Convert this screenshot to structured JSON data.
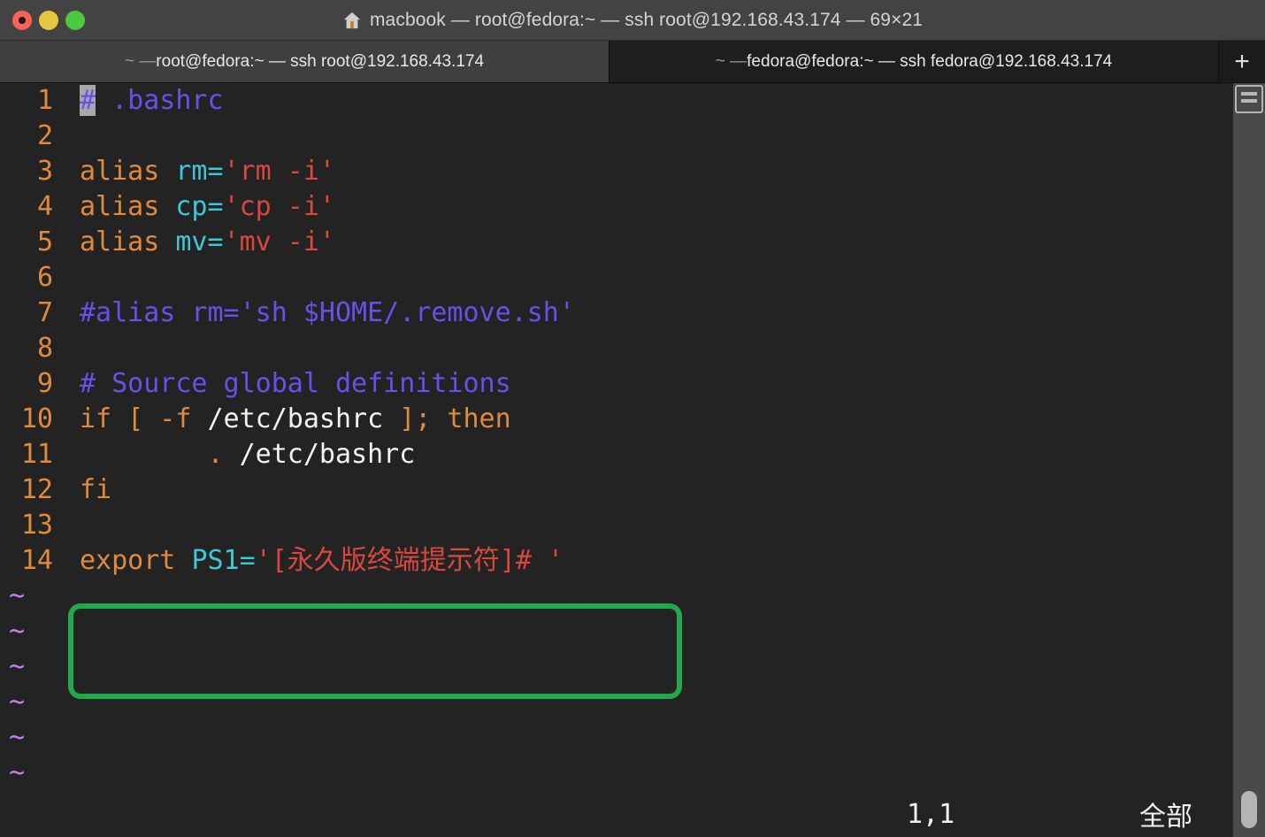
{
  "window": {
    "title": "macbook — root@fedora:~ — ssh root@192.168.43.174 — 69×21",
    "icon": "house-icon",
    "controls": {
      "close": "close-button",
      "minimize": "minimize-button",
      "zoom": "zoom-button"
    }
  },
  "tabs": [
    {
      "prefix": "~ — ",
      "label": "root@fedora:~ — ssh root@192.168.43.174",
      "active": true
    },
    {
      "prefix": "~ — ",
      "label": "fedora@fedora:~ — ssh fedora@192.168.43.174",
      "active": false
    }
  ],
  "new_tab_label": "+",
  "editor": {
    "lines": [
      {
        "num": "1",
        "segments": [
          {
            "text": "#",
            "cls": "cursor"
          },
          {
            "text": " .bashrc",
            "cls": "c-comment"
          }
        ]
      },
      {
        "num": "2",
        "segments": []
      },
      {
        "num": "3",
        "segments": [
          {
            "text": "alias ",
            "cls": "c-kw"
          },
          {
            "text": "rm=",
            "cls": "c-var"
          },
          {
            "text": "'rm -i'",
            "cls": "c-str"
          }
        ]
      },
      {
        "num": "4",
        "segments": [
          {
            "text": "alias ",
            "cls": "c-kw"
          },
          {
            "text": "cp=",
            "cls": "c-var"
          },
          {
            "text": "'cp -i'",
            "cls": "c-str"
          }
        ]
      },
      {
        "num": "5",
        "segments": [
          {
            "text": "alias ",
            "cls": "c-kw"
          },
          {
            "text": "mv=",
            "cls": "c-var"
          },
          {
            "text": "'mv -i'",
            "cls": "c-str"
          }
        ]
      },
      {
        "num": "6",
        "segments": []
      },
      {
        "num": "7",
        "segments": [
          {
            "text": "#alias rm='sh $HOME/.remove.sh'",
            "cls": "c-comment"
          }
        ]
      },
      {
        "num": "8",
        "segments": []
      },
      {
        "num": "9",
        "segments": [
          {
            "text": "# Source global definitions",
            "cls": "c-comment"
          }
        ]
      },
      {
        "num": "10",
        "segments": [
          {
            "text": "if [ -f ",
            "cls": "c-kw"
          },
          {
            "text": "/etc/bashrc",
            "cls": "c-plain"
          },
          {
            "text": " ]; then",
            "cls": "c-kw"
          }
        ]
      },
      {
        "num": "11",
        "segments": [
          {
            "text": "        . ",
            "cls": "c-kw"
          },
          {
            "text": "/etc/bashrc",
            "cls": "c-plain"
          }
        ]
      },
      {
        "num": "12",
        "segments": [
          {
            "text": "fi",
            "cls": "c-kw"
          }
        ]
      },
      {
        "num": "13",
        "segments": []
      },
      {
        "num": "14",
        "segments": [
          {
            "text": "export ",
            "cls": "c-kw"
          },
          {
            "text": "PS1=",
            "cls": "c-var"
          },
          {
            "text": "'[永久版终端提示符]# '",
            "cls": "c-str"
          }
        ]
      }
    ],
    "tilde_rows": 6,
    "tilde_char": "~"
  },
  "annotation": {
    "shape": "rounded-rectangle",
    "color": "#22a94b",
    "targets_line": "14"
  },
  "status": {
    "position": "1,1",
    "scroll": "全部"
  },
  "colors": {
    "titlebar": "#434343",
    "tab_active": "#3f3f3f",
    "tab_inactive": "#1e1e1e",
    "terminal_bg": "#232323",
    "comment": "#6b4fe8",
    "keyword": "#e08a3c",
    "variable": "#3fc7d6",
    "string": "#d9483f",
    "plain": "#f2f2f2",
    "line_number": "#e08a3c",
    "tilde": "#c481e8",
    "annotation": "#22a94b",
    "scrollbar_thumb": "#b4b4b4"
  }
}
